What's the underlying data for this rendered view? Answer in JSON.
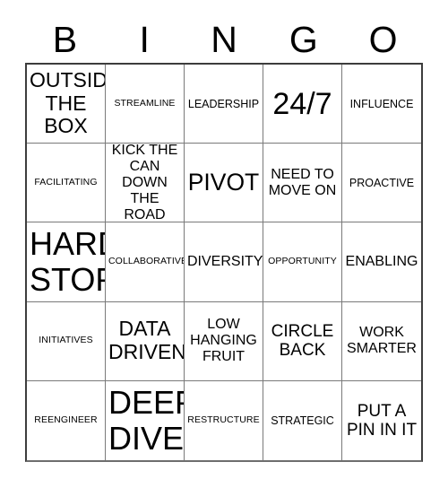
{
  "card": {
    "title": "BINGO",
    "header_letters": [
      "B",
      "I",
      "N",
      "G",
      "O"
    ],
    "columns": 5,
    "rows": 5,
    "colors": {
      "background": "#ffffff",
      "text": "#000000",
      "grid_outer_border": "#3d3d3d",
      "grid_inner_border": "#7a7a7a"
    },
    "cells": [
      {
        "text": "OUTSIDE THE BOX",
        "size": "xl",
        "row": 1,
        "col": 1
      },
      {
        "text": "STREAMLINE",
        "size": "xs",
        "row": 1,
        "col": 2
      },
      {
        "text": "LEADERSHIP",
        "size": "sm",
        "row": 1,
        "col": 3
      },
      {
        "text": "24/7",
        "size": "huge",
        "row": 1,
        "col": 4
      },
      {
        "text": "INFLUENCE",
        "size": "sm",
        "row": 1,
        "col": 5
      },
      {
        "text": "FACILITATING",
        "size": "xs",
        "row": 2,
        "col": 1
      },
      {
        "text": "KICK THE CAN DOWN THE ROAD",
        "size": "md",
        "row": 2,
        "col": 2
      },
      {
        "text": "PIVOT",
        "size": "xxl",
        "row": 2,
        "col": 3
      },
      {
        "text": "NEED TO MOVE ON",
        "size": "md",
        "row": 2,
        "col": 4
      },
      {
        "text": "PROACTIVE",
        "size": "sm",
        "row": 2,
        "col": 5
      },
      {
        "text": "HARD STOP",
        "size": "mega",
        "row": 3,
        "col": 1
      },
      {
        "text": "COLLABORATIVE",
        "size": "xs",
        "row": 3,
        "col": 2
      },
      {
        "text": "DIVERSITY",
        "size": "md",
        "row": 3,
        "col": 3
      },
      {
        "text": "OPPORTUNITY",
        "size": "xs",
        "row": 3,
        "col": 4
      },
      {
        "text": "ENABLING",
        "size": "md",
        "row": 3,
        "col": 5
      },
      {
        "text": "INITIATIVES",
        "size": "xs",
        "row": 4,
        "col": 1
      },
      {
        "text": "DATA DRIVEN",
        "size": "xl",
        "row": 4,
        "col": 2
      },
      {
        "text": "LOW HANGING FRUIT",
        "size": "md",
        "row": 4,
        "col": 3
      },
      {
        "text": "CIRCLE BACK",
        "size": "lg",
        "row": 4,
        "col": 4
      },
      {
        "text": "WORK SMARTER",
        "size": "md",
        "row": 4,
        "col": 5
      },
      {
        "text": "REENGINEER",
        "size": "xs",
        "row": 5,
        "col": 1
      },
      {
        "text": "DEEP DIVE",
        "size": "mega",
        "row": 5,
        "col": 2
      },
      {
        "text": "RESTRUCTURE",
        "size": "xs",
        "row": 5,
        "col": 3
      },
      {
        "text": "STRATEGIC",
        "size": "sm",
        "row": 5,
        "col": 4
      },
      {
        "text": "PUT A PIN IN IT",
        "size": "lg",
        "row": 5,
        "col": 5
      }
    ]
  }
}
